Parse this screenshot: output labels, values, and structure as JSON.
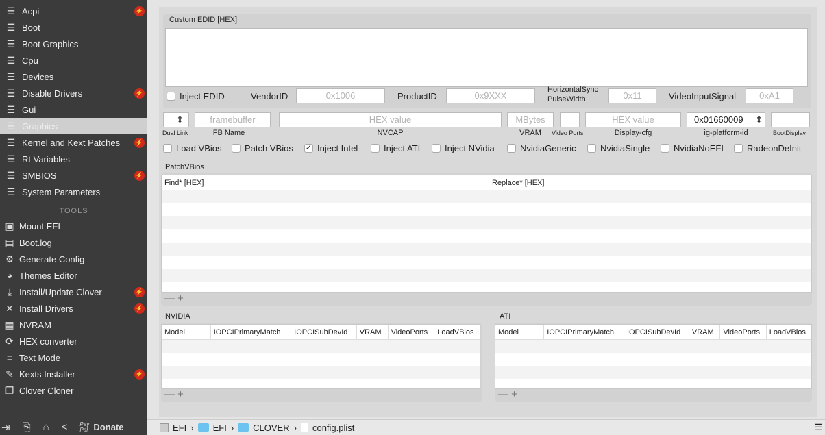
{
  "sidebar": {
    "items": [
      {
        "label": "Acpi",
        "badge": true
      },
      {
        "label": "Boot",
        "badge": false
      },
      {
        "label": "Boot Graphics",
        "badge": false
      },
      {
        "label": "Cpu",
        "badge": false
      },
      {
        "label": "Devices",
        "badge": false
      },
      {
        "label": "Disable Drivers",
        "badge": true
      },
      {
        "label": "Gui",
        "badge": false
      },
      {
        "label": "Graphics",
        "badge": false,
        "selected": true
      },
      {
        "label": "Kernel and Kext Patches",
        "badge": true
      },
      {
        "label": "Rt Variables",
        "badge": false
      },
      {
        "label": "SMBIOS",
        "badge": true
      },
      {
        "label": "System Parameters",
        "badge": false
      }
    ],
    "tools_header": "TOOLS",
    "tools": [
      {
        "label": "Mount EFI",
        "icon": "disk-icon"
      },
      {
        "label": "Boot.log",
        "icon": "log-icon"
      },
      {
        "label": "Generate Config",
        "icon": "gears-icon"
      },
      {
        "label": "Themes Editor",
        "icon": "palette-icon"
      },
      {
        "label": "Install/Update Clover",
        "icon": "download-icon",
        "badge": true
      },
      {
        "label": "Install Drivers",
        "icon": "tools-icon",
        "badge": true
      },
      {
        "label": "NVRAM",
        "icon": "chip-icon"
      },
      {
        "label": "HEX converter",
        "icon": "refresh-icon"
      },
      {
        "label": "Text Mode",
        "icon": "text-icon"
      },
      {
        "label": "Kexts Installer",
        "icon": "brush-icon",
        "badge": true
      },
      {
        "label": "Clover Cloner",
        "icon": "copy-icon"
      }
    ],
    "donate_label": "Donate",
    "paypal": "Pay Pal"
  },
  "edid": {
    "title": "Custom EDID [HEX]",
    "inject_label": "Inject EDID",
    "inject_checked": false,
    "vendor_label": "VendorID",
    "vendor_placeholder": "0x1006",
    "product_label": "ProductID",
    "product_placeholder": "0x9XXX",
    "hsync_label1": "HorizontalSync",
    "hsync_label2": "PulseWidth",
    "hsync_placeholder": "0x11",
    "vis_label": "VideoInputSignal",
    "vis_placeholder": "0xA1"
  },
  "fields": {
    "dual_link": "Dual Link",
    "fb_name": "FB Name",
    "fb_placeholder": "framebuffer",
    "nvcap": "NVCAP",
    "nvcap_placeholder": "HEX value",
    "vram": "VRAM",
    "vram_placeholder": "MBytes",
    "video_ports": "Video Ports",
    "display_cfg": "Display-cfg",
    "display_cfg_placeholder": "HEX value",
    "ig_platform": "ig-platform-id",
    "ig_platform_value": "0x01660009",
    "boot_display": "BootDisplay"
  },
  "checks": [
    {
      "label": "Load VBios",
      "checked": false
    },
    {
      "label": "Patch VBios",
      "checked": false
    },
    {
      "label": "Inject Intel",
      "checked": true
    },
    {
      "label": "Inject ATI",
      "checked": false
    },
    {
      "label": "Inject NVidia",
      "checked": false
    },
    {
      "label": "NvidiaGeneric",
      "checked": false
    },
    {
      "label": "NvidiaSingle",
      "checked": false
    },
    {
      "label": "NvidiaNoEFI",
      "checked": false
    },
    {
      "label": "RadeonDeInit",
      "checked": false
    }
  ],
  "patch": {
    "title": "PatchVBios",
    "cols": [
      "Find* [HEX]",
      "Replace* [HEX]"
    ]
  },
  "nvidia": {
    "title": "NVIDIA",
    "cols": [
      "Model",
      "IOPCIPrimaryMatch",
      "IOPCISubDevId",
      "VRAM",
      "VideoPorts",
      "LoadVBios"
    ]
  },
  "ati": {
    "title": "ATI",
    "cols": [
      "Model",
      "IOPCIPrimaryMatch",
      "IOPCISubDevId",
      "VRAM",
      "VideoPorts",
      "LoadVBios"
    ]
  },
  "path": [
    "EFI",
    "EFI",
    "CLOVER",
    "config.plist"
  ]
}
